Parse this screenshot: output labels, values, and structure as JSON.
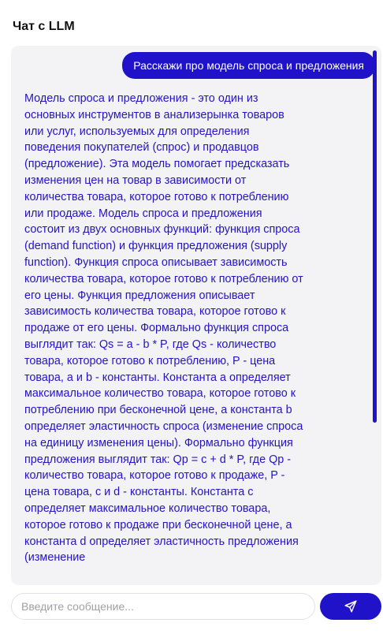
{
  "app": {
    "title": "Чат с LLM"
  },
  "chat": {
    "messages": [
      {
        "role": "user",
        "text": "Расскажи про модель спроса и предложения"
      },
      {
        "role": "assistant",
        "text": "Модель спроса и предложения - это один из основных инструментов в анализерынка товаров или услуг, используемых для определения поведения покупателей (спрос) и продавцов (предложение). Эта модель помогает предсказать изменения цен на товар в зависимости от количества товара, которое готово к потреблению или продаже. Модель спроса и предложения состоит из двух основных функций: функция спроса (demand function) и функция предложения (supply function). Функция спроса описывает зависимость количества товара, которое готово к потреблению от его цены. Функция предложения описывает зависимость количества товара, которое готово к продаже от его цены. Формально функция спроса выглядит так: Qs = a - b * P, где Qs - количество товара, которое готово к потреблению, P - цена товара, a и b - константы. Константа a определяет максимальное количество товара, которое готово к потреблению при бесконечной цене, а константа b определяет эластичность спроса (изменение спроса на единицу изменения цены). Формально функция предложения выглядит так: Qp = c + d * P, где Qp - количество товара, которое готово к продаже, P - цена товара, c и d - константы. Константа c определяет максимальное количество товара, которое готово к продаже при бесконечной цене, а константа d определяет эластичность предложения (изменение"
      }
    ]
  },
  "input": {
    "placeholder": "Введите сообщение...",
    "value": ""
  },
  "send_button": {
    "icon": "send-icon"
  },
  "colors": {
    "accent": "#1f12c9",
    "assistant_text": "#2514c4",
    "chat_background": "#f3f3f5"
  }
}
